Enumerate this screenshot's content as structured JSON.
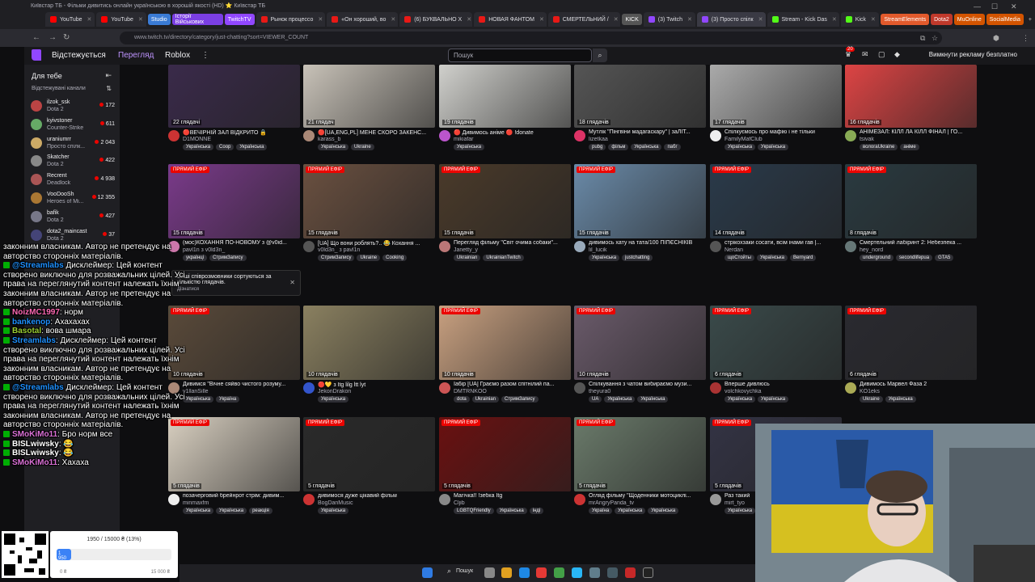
{
  "browser": {
    "window_title": "Київстар ТБ - Фільми дивитись онлайн українською в хорошій якості (HD) ⭐ Київстар ТБ",
    "tabs": [
      {
        "label": "YouTube",
        "color": "#ff0000"
      },
      {
        "label": "YouTube",
        "color": "#ff0000"
      },
      {
        "label": "Рынок процессо",
        "color": "#e91916"
      },
      {
        "label": "«Он хороший, во",
        "color": "#e91916"
      },
      {
        "label": "(6) БУКВАЛЬНО Х",
        "color": "#e91916"
      },
      {
        "label": "НОВАЯ ФАНТОМ",
        "color": "#e91916"
      },
      {
        "label": "СМЕРТЕЛЬНИЙ /",
        "color": "#e91916"
      },
      {
        "label": "(3) Twitch",
        "color": "#9147ff"
      },
      {
        "label": "(3) Просто спілк",
        "color": "#9147ff"
      },
      {
        "label": "Stream - Kick Das",
        "color": "#53fc18"
      },
      {
        "label": "Kick",
        "color": "#53fc18"
      }
    ],
    "group_badges": [
      {
        "label": "Studio",
        "color": "#3a7bd5"
      },
      {
        "label": "Історії Військових",
        "color": "#7b3fe4"
      },
      {
        "label": "TwitchTV",
        "color": "#9147ff"
      },
      {
        "label": "KICK",
        "color": "#555555"
      },
      {
        "label": "StreamElements",
        "color": "#e25a2c"
      },
      {
        "label": "Dota2",
        "color": "#c0392b"
      },
      {
        "label": "MuOnline",
        "color": "#d35400"
      },
      {
        "label": "SocialMedia",
        "color": "#d35400"
      }
    ],
    "url": "www.twitch.tv/directory/category/just-chatting?sort=VIEWER_COUNT"
  },
  "twitch_nav": {
    "following": "Відстежується",
    "browse": "Перегляд",
    "roblox": "Roblox",
    "more": "⋮",
    "search_placeholder": "Пошук",
    "notif_count": "20",
    "ad_free": "Вимкнути рекламу безплатно"
  },
  "sidebar": {
    "heading": "Для тебе",
    "subheading": "Відстежувані канали",
    "items": [
      {
        "name": "ilzok_ssk",
        "game": "Dota 2",
        "viewers": "172",
        "color": "#b44"
      },
      {
        "name": "kyivstoner",
        "game": "Counter-Strike",
        "viewers": "611",
        "color": "#6a6"
      },
      {
        "name": "uraniumrr",
        "game": "Просто спілк...",
        "viewers": "2 043",
        "color": "#ca6"
      },
      {
        "name": "Skatcher",
        "game": "Dota 2",
        "viewers": "422",
        "color": "#888"
      },
      {
        "name": "Recrent",
        "game": "Deadlock",
        "viewers": "4 938",
        "color": "#a55"
      },
      {
        "name": "VooDooSh",
        "game": "Heroes of Mi...",
        "viewers": "12 355",
        "color": "#a73"
      },
      {
        "name": "bafik",
        "game": "Dota 2",
        "viewers": "427",
        "color": "#778"
      },
      {
        "name": "dota2_maincast",
        "game": "Dota 2",
        "viewers": "37",
        "color": "#447"
      }
    ]
  },
  "cards": [
    {
      "viewers": "22 глядачі",
      "title": "🔴ВЕЧІРНІЙ ЗАЛ ВІДКРИТО 🔒",
      "name": "D1MONNE",
      "tags": [
        "Українська",
        "Coop",
        "Українська"
      ],
      "bg": "#3a2a4a",
      "av": "#c33"
    },
    {
      "viewers": "21 глядач",
      "title": "🔴[UA,ENG,PL] МЕНЕ СКОРО ЗАКЕНС...",
      "name": "karass_b",
      "tags": [
        "Українська",
        "Ukraine"
      ],
      "bg": "#c8c2b8",
      "av": "#a87"
    },
    {
      "viewers": "19 глядачів",
      "title": "🔴 Дивимось аніме 🔴 !donate",
      "name": "mikiafar",
      "tags": [
        "Українська"
      ],
      "bg": "#d0d0cc",
      "av": "#b5c"
    },
    {
      "viewers": "18 глядачів",
      "title": "Мутлік \"Пінгвіни мадагаскару\" | заЛІТ...",
      "name": "lizetkaa",
      "tags": [
        "pubg",
        "фільм",
        "Українська",
        "пабг"
      ],
      "bg": "#555",
      "av": "#d36"
    },
    {
      "viewers": "17 глядачів",
      "title": "Спілкуємось про мафію і не тільки",
      "name": "FamilyMafClub",
      "tags": [
        "Українська",
        "Українська"
      ],
      "bg": "#aaa",
      "av": "#eee"
    },
    {
      "viewers": "16 глядачів",
      "title": "АНІМЕЗАЛ: КІЛЛ ЛА КІЛЛ ФІНАЛ | ГО...",
      "name": "tsivak",
      "tags": [
        "вологаUkraine",
        "аніме"
      ],
      "bg": "#d44",
      "av": "#8a5"
    },
    {
      "viewers": "15 глядачів",
      "title": "(мос)КОХАННЯ ПО-НОВОМУ з @v0id...",
      "name": "pavl1n з v0ld3n_",
      "tags": [
        "українці",
        "СтримЗапису"
      ],
      "bg": "#7a3a8a",
      "av": "#c7a",
      "live": true
    },
    {
      "viewers": "15 глядачів",
      "title": "[UA] Що вони роблять?.. 😂 Кохання ...",
      "name": "v0ld3n_ з pavl1n",
      "tags": [
        "СтримЗапису",
        "Ukraine",
        "Cooking"
      ],
      "bg": "#6a5040",
      "av": "#555",
      "live": true
    },
    {
      "viewers": "15 глядачів",
      "title": "Перегляд фільму \"Світ очима собаки\"...",
      "name": "Janetty_y",
      "tags": [
        "Ukrainian",
        "UkrainianTwitch"
      ],
      "bg": "#4a3a2a",
      "av": "#b77",
      "live": true
    },
    {
      "viewers": "15 глядачів",
      "title": "дивимось хату на тата/100 ПІПЄСНІКІВ",
      "name": "lil_lucik",
      "tags": [
        "Українська",
        "justchatting"
      ],
      "bg": "#6a8aa8",
      "av": "#9ab",
      "live": true
    },
    {
      "viewers": "14 глядачів",
      "title": "стрікохзаки сосати, всім інами гав |...",
      "name": "Nerdan",
      "tags": [
        "щоСтойты",
        "Українська",
        "Bernyard"
      ],
      "bg": "#2a3a4a",
      "av": "#555",
      "live": true
    },
    {
      "viewers": "8 глядачів",
      "title": "Смертельний лабіринт 2: Небезпека ...",
      "name": "hey_nord",
      "tags": [
        "underground",
        "secondlifepua",
        "GTA5"
      ],
      "bg": "#2a3a40",
      "av": "#677",
      "live": true
    },
    {
      "viewers": "10 глядачів",
      "title": "Дивимся \"Вічне сяйво чистого розуму...",
      "name": "v1llanSille",
      "tags": [
        "Українська",
        "Україна"
      ],
      "bg": "#5a4a3a",
      "av": "#a87",
      "live": true
    },
    {
      "viewers": "10 глядачів",
      "title": "🔴💛 з Itg lilg ltt lyt",
      "name": "JekonDrakon",
      "tags": [
        "Українська"
      ],
      "bg": "#8a8060",
      "av": "#35c",
      "live": false
    },
    {
      "viewers": "10 глядачів",
      "title": "Ia6ip [UA] Граємо разом спітнілий па...",
      "name": "DMTRNKOO",
      "tags": [
        "dota",
        "Ukrainian",
        "СтримЗапису"
      ],
      "bg": "#c8a080",
      "av": "#c55",
      "live": true
    },
    {
      "viewers": "10 глядачів",
      "title": "Спілкування з чатом вибираємо музи...",
      "name": "theyura0",
      "tags": [
        "UA",
        "Українська",
        "Українська"
      ],
      "bg": "#6a5a6a",
      "av": "#555",
      "live": true
    },
    {
      "viewers": "6 глядачів",
      "title": "Вперше дивлюсь",
      "name": "volchkovychka",
      "tags": [
        "Українська",
        "Українська"
      ],
      "bg": "#3a4a4a",
      "av": "#a33",
      "live": true
    },
    {
      "viewers": "6 глядачів",
      "title": "Дивимось Марвел Фаза 2",
      "name": "KO1eks",
      "tags": [
        "Ukraine",
        "Українська"
      ],
      "bg": "#2a2a30",
      "av": "#aa5",
      "live": true
    },
    {
      "viewers": "5 глядачів",
      "title": "позачерговий брейнрот стрім: дивим...",
      "name": "minmaxfm",
      "tags": [
        "Українська",
        "Українська",
        "реакція"
      ],
      "bg": "#d8cfc0",
      "av": "#eee",
      "live": true
    },
    {
      "viewers": "5 глядачів",
      "title": "дивимося дуже цікавий фільм",
      "name": "BogDanMusic",
      "tags": [
        "Українська"
      ],
      "bg": "#2a2a2a",
      "av": "#c33",
      "live": true
    },
    {
      "viewers": "5 глядачів",
      "title": "Магічка!! !зебка Itg",
      "name": "Cljib",
      "tags": [
        "LGBTQFriendly",
        "Українська",
        "інді"
      ],
      "bg": "#6a1010",
      "av": "#888",
      "live": true
    },
    {
      "viewers": "5 глядачів",
      "title": "Огляд фільму \"Щоденники мотоциклі...",
      "name": "mrAngryPanda_tv",
      "tags": [
        "Україна",
        "Українська",
        "Українська"
      ],
      "bg": "#6a7a6a",
      "av": "#c33",
      "live": true
    },
    {
      "viewers": "5 глядачів",
      "title": "Раз такий",
      "name": "mirt_tyo",
      "tags": [
        "Українська"
      ],
      "bg": "#334",
      "av": "#999",
      "live": true
    }
  ],
  "live_label": "ПРЯМИЙ ЕФІР",
  "tooltip": {
    "text": "Ваші співрозмовники сортуються за кількістю глядачів.",
    "link": "Дізнатися"
  },
  "chat": {
    "lines": [
      {
        "text": "законним власникам. Автор не претендує на",
        "badge": false
      },
      {
        "text": "авторство сторонніх матеріалів.",
        "badge": false
      },
      {
        "user": "@Streamlabs",
        "text": " Дисклеймер: Цей контент",
        "badge": true,
        "ucolor": "#1e90ff"
      },
      {
        "text": "створено виключно для розважальних цілей. Усі",
        "badge": false
      },
      {
        "text": "права на переглянутий контент належать їхнім",
        "badge": false
      },
      {
        "text": "законним власникам. Автор не претендує на",
        "badge": false
      },
      {
        "text": "авторство сторонніх матеріалів.",
        "badge": false
      },
      {
        "user": "NoizMC1997",
        "text": ": норм",
        "badge": true,
        "ucolor": "#ff69b4"
      },
      {
        "user": "bankenop",
        "text": ": Ахахахах",
        "badge": true,
        "ucolor": "#1e90ff"
      },
      {
        "user": "Basotal",
        "text": ": вова шмара",
        "badge": true,
        "ucolor": "#9acd32"
      },
      {
        "user": "Streamlabs",
        "text": ": Дисклеймер: Цей контент",
        "badge": true,
        "ucolor": "#1e90ff"
      },
      {
        "text": "створено виключно для розважальних цілей. Усі",
        "badge": false
      },
      {
        "text": "права на переглянутий контент належать їхнім",
        "badge": false
      },
      {
        "text": "законним власникам. Автор не претендує на",
        "badge": false
      },
      {
        "text": "авторство сторонніх матеріалів.",
        "badge": false
      },
      {
        "user": "@Streamlabs",
        "text": " Дисклеймер: Цей контент",
        "badge": true,
        "ucolor": "#1e90ff"
      },
      {
        "text": "створено виключно для розважальних цілей. Усі",
        "badge": false
      },
      {
        "text": "права на переглянутий контент належать їхнім",
        "badge": false
      },
      {
        "text": "законним власникам. Автор не претендує на",
        "badge": false
      },
      {
        "text": "авторство сторонніх матеріалів.",
        "badge": false
      },
      {
        "user": "SMoKiMo11",
        "text": ": Бро норм все",
        "badge": true,
        "ucolor": "#da70d6"
      },
      {
        "user": "BISLwiwsky",
        "text": ": 😂",
        "badge": true,
        "ucolor": "#ffffff"
      },
      {
        "user": "BISLwiwsky",
        "text": ": 😂",
        "badge": true,
        "ucolor": "#ffffff"
      },
      {
        "user": "SMoKiMo11",
        "text": ": Хахаха",
        "badge": true,
        "ucolor": "#da70d6"
      }
    ]
  },
  "donation": {
    "progress_text": "1950 / 15000 ₴ (13%)",
    "progress_fraction": 0.13,
    "bar_label": "1 950",
    "min": "0 ₴",
    "max": "15 000 ₴"
  },
  "taskbar": {
    "search": "Пошук"
  }
}
